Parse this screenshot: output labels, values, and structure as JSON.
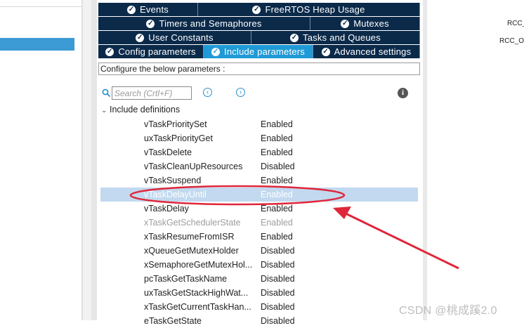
{
  "tabs": {
    "row1": [
      "Events",
      "FreeRTOS Heap Usage"
    ],
    "row2": [
      "Timers and Semaphores",
      "Mutexes"
    ],
    "row3": [
      "User Constants",
      "Tasks and Queues"
    ],
    "row4": [
      "Config parameters",
      "Include parameters",
      "Advanced settings"
    ],
    "active": "Include parameters"
  },
  "configure_label": "Configure the below parameters :",
  "search": {
    "placeholder": "Search (Crtl+F)"
  },
  "group_label": "Include definitions",
  "parameters": [
    {
      "name": "vTaskPrioritySet",
      "value": "Enabled"
    },
    {
      "name": "uxTaskPriorityGet",
      "value": "Enabled"
    },
    {
      "name": "vTaskDelete",
      "value": "Enabled"
    },
    {
      "name": "vTaskCleanUpResources",
      "value": "Disabled"
    },
    {
      "name": "vTaskSuspend",
      "value": "Enabled"
    },
    {
      "name": "vTaskDelayUntil",
      "value": "Enabled"
    },
    {
      "name": "vTaskDelay",
      "value": "Enabled"
    },
    {
      "name": "xTaskGetSchedulerState",
      "value": "Enabled"
    },
    {
      "name": "xTaskResumeFromISR",
      "value": "Enabled"
    },
    {
      "name": "xQueueGetMutexHolder",
      "value": "Disabled"
    },
    {
      "name": "xSemaphoreGetMutexHol...",
      "value": "Disabled"
    },
    {
      "name": "pcTaskGetTaskName",
      "value": "Disabled"
    },
    {
      "name": "uxTaskGetStackHighWat...",
      "value": "Disabled"
    },
    {
      "name": "xTaskGetCurrentTaskHan...",
      "value": "Disabled"
    },
    {
      "name": "eTaskGetState",
      "value": "Disabled"
    }
  ],
  "right_labels": [
    "RCC_",
    "RCC_O"
  ],
  "watermark": "CSDN @桃成蹊2.0",
  "colors": {
    "tab_bg": "#0b2a4a",
    "tab_active": "#1f9ad6",
    "selection": "#c2d9ef",
    "annotation": "#e0263a"
  }
}
